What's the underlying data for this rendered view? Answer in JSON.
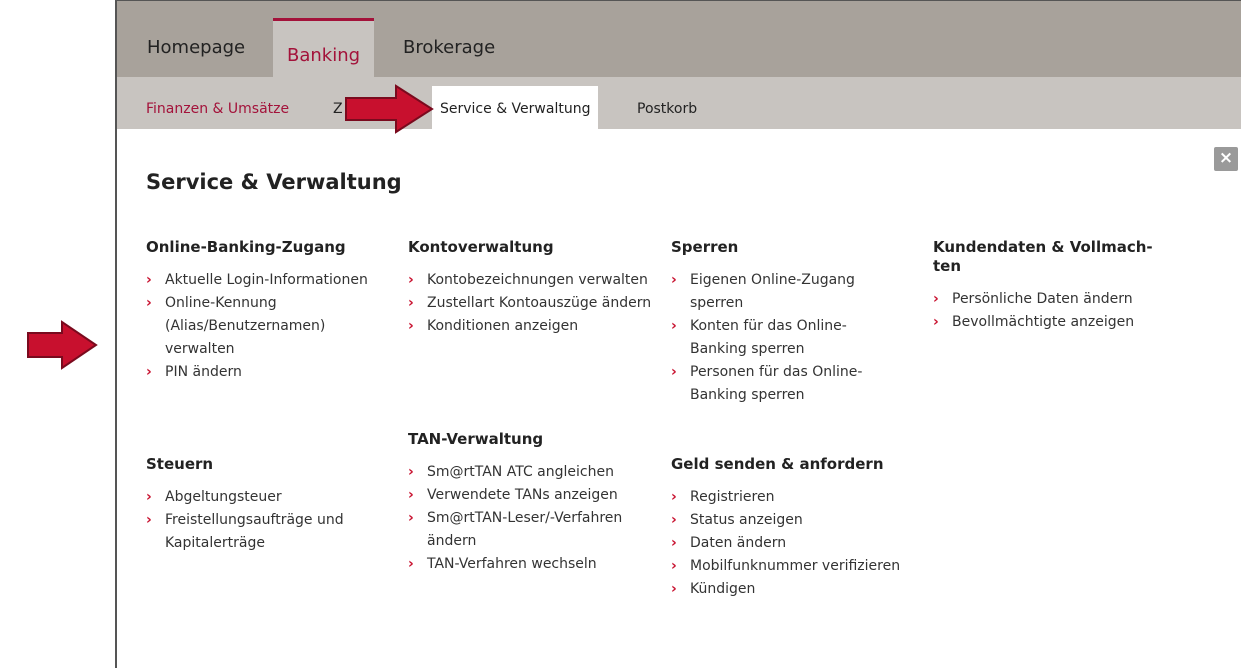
{
  "nav": {
    "top_tabs": [
      {
        "label": "Homepage"
      },
      {
        "label": "Banking"
      },
      {
        "label": "Brokerage"
      }
    ],
    "sub_tabs": [
      {
        "label": "Finanzen & Umsätze"
      },
      {
        "label": "Z"
      },
      {
        "label": "Service & Verwaltung"
      },
      {
        "label": "Postkorb"
      }
    ]
  },
  "page": {
    "title": "Service & Verwaltung",
    "close_glyph": "×"
  },
  "icons": {
    "chevron": "chevron-right-icon",
    "close": "close-icon",
    "arrow": "arrow-right-icon"
  },
  "colors": {
    "accent": "#c8102e",
    "brand_red": "#a3123a",
    "top_nav_bg": "#a8a29b",
    "sub_nav_bg": "#c8c4c0"
  },
  "sections": [
    {
      "title": "Online-Banking-Zugang",
      "items": [
        "Aktuelle Login-Informationen",
        "Online-Kennung (Alias/Benutzernamen) verwalten",
        "PIN ändern"
      ]
    },
    {
      "title": "Steuern",
      "items": [
        "Abgeltungsteuer",
        "Freistellungsaufträge und Kapitalerträge"
      ]
    },
    {
      "title": "Kontoverwaltung",
      "items": [
        "Kontobezeichnungen verwalten",
        "Zustellart Kontoauszüge ändern",
        "Konditionen anzeigen"
      ]
    },
    {
      "title": "TAN-Verwaltung",
      "items": [
        "Sm@rtTAN ATC angleichen",
        "Verwendete TANs anzeigen",
        "Sm@rtTAN-Leser/-Verfahren ändern",
        "TAN-Verfahren wechseln"
      ]
    },
    {
      "title": "Sperren",
      "items": [
        "Eigenen Online-Zugang sperren",
        "Konten für das Online-Banking sperren",
        "Personen für das Online-Banking sperren"
      ]
    },
    {
      "title": "Geld senden & anfordern",
      "items": [
        "Registrieren",
        "Status anzeigen",
        "Daten ändern",
        "Mobilfunknummer verifizieren",
        "Kündigen"
      ]
    },
    {
      "title": "Kundendaten & Vollmach-ten",
      "items": [
        "Persönliche Daten ändern",
        "Bevollmächtigte anzeigen"
      ]
    }
  ]
}
